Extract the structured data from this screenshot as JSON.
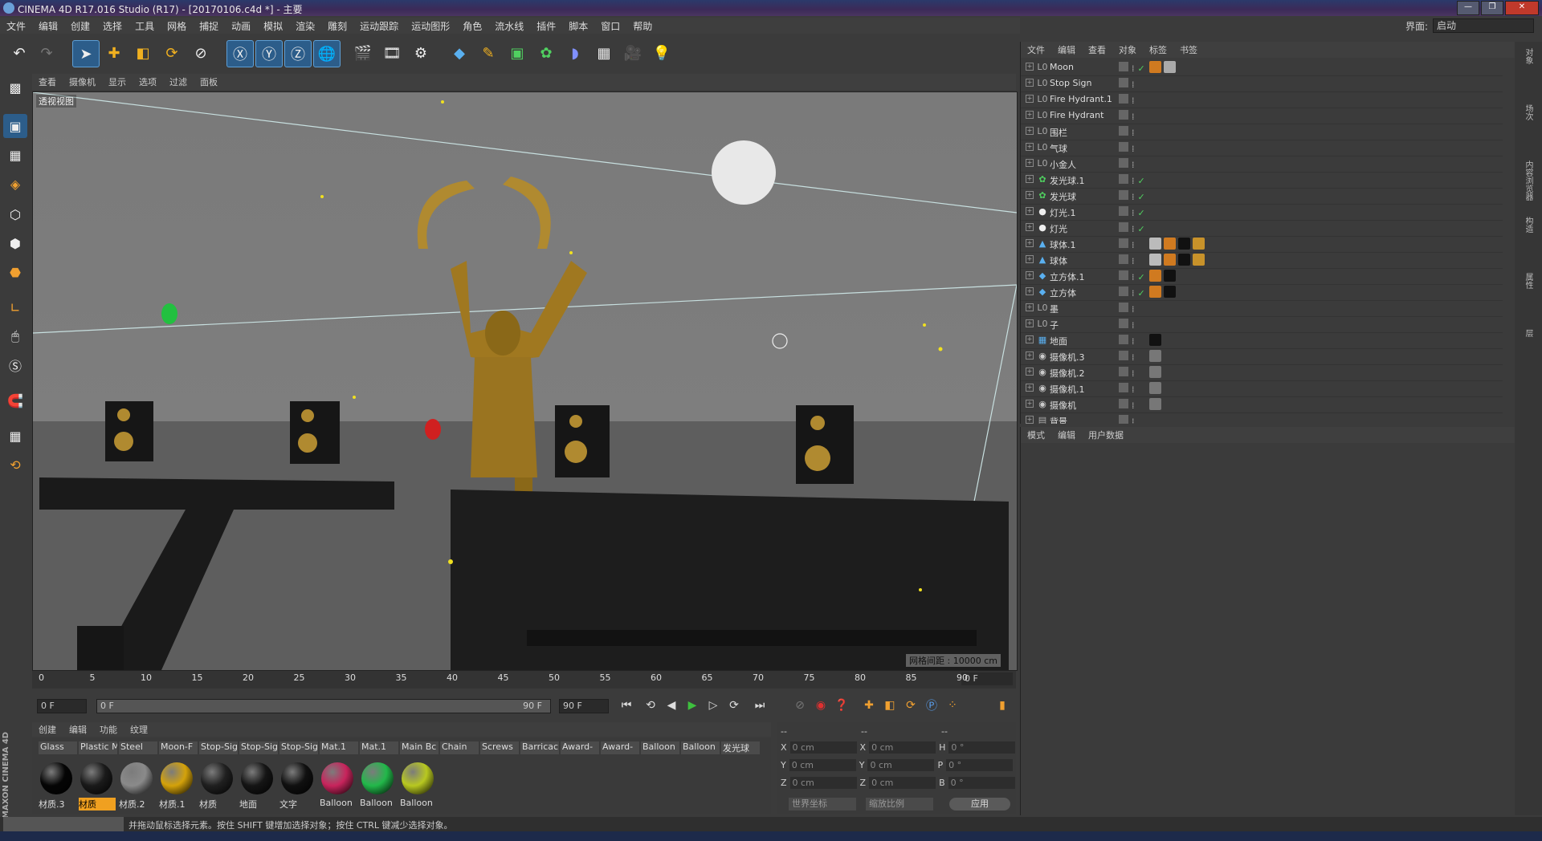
{
  "window": {
    "title": "CINEMA 4D R17.016 Studio (R17) - [20170106.c4d *] - 主要"
  },
  "menu": [
    "文件",
    "编辑",
    "创建",
    "选择",
    "工具",
    "网格",
    "捕捉",
    "动画",
    "模拟",
    "渲染",
    "雕刻",
    "运动跟踪",
    "运动图形",
    "角色",
    "流水线",
    "插件",
    "脚本",
    "窗口",
    "帮助"
  ],
  "layout": {
    "label": "界面:",
    "value": "启动"
  },
  "viewport": {
    "menu": [
      "查看",
      "摄像机",
      "显示",
      "选项",
      "过滤",
      "面板"
    ],
    "label": "透视视图",
    "grid_spacing": "网格间距 : 10000 cm"
  },
  "timeline": {
    "ticks": [
      "0",
      "5",
      "10",
      "15",
      "20",
      "25",
      "30",
      "35",
      "40",
      "45",
      "50",
      "55",
      "60",
      "65",
      "70",
      "75",
      "80",
      "85",
      "90"
    ],
    "current_frame": "0 F"
  },
  "playback": {
    "start": "0 F",
    "range_start": "0 F",
    "range_end": "90 F",
    "end": "90 F"
  },
  "materials": {
    "menu": [
      "创建",
      "编辑",
      "功能",
      "纹理"
    ],
    "tabs": [
      "Glass",
      "Plastic M",
      "Steel",
      "Moon-F",
      "Stop-Sig",
      "Stop-Sig",
      "Stop-Sig",
      "Mat.1",
      "Mat.1",
      "Main Bc",
      "Chain",
      "Screws",
      "Barricac",
      "Award-",
      "Award-",
      "Balloon",
      "Balloon",
      "发光球"
    ],
    "items": [
      {
        "name": "材质.3",
        "color": "#050505"
      },
      {
        "name": "材质",
        "color": "#1a1a1a"
      },
      {
        "name": "材质.2",
        "color": "#8a8a8a"
      },
      {
        "name": "材质.1",
        "color": "#d4a20a"
      },
      {
        "name": "材质",
        "color": "#202020"
      },
      {
        "name": "地面",
        "color": "#151515"
      },
      {
        "name": "文字",
        "color": "#101010"
      },
      {
        "name": "Balloon",
        "color": "#c8245c"
      },
      {
        "name": "Balloon",
        "color": "#22b84a"
      },
      {
        "name": "Balloon",
        "color": "#b8c820"
      }
    ]
  },
  "coords": {
    "headers": [
      "--",
      "--",
      "--"
    ],
    "rows": [
      {
        "a": "X",
        "av": "0 cm",
        "b": "X",
        "bv": "0 cm",
        "c": "H",
        "cv": "0 °"
      },
      {
        "a": "Y",
        "av": "0 cm",
        "b": "Y",
        "bv": "0 cm",
        "c": "P",
        "cv": "0 °"
      },
      {
        "a": "Z",
        "av": "0 cm",
        "b": "Z",
        "bv": "0 cm",
        "c": "B",
        "cv": "0 °"
      }
    ],
    "world": "世界坐标",
    "scale": "缩放比例",
    "apply": "应用"
  },
  "objects": {
    "menu": [
      "文件",
      "编辑",
      "查看",
      "对象",
      "标签",
      "书签"
    ],
    "rows": [
      {
        "name": "Moon",
        "icon": "null",
        "check": true,
        "tags": [
          "#d07a20",
          "#aaaaaa"
        ]
      },
      {
        "name": "Stop Sign",
        "icon": "null",
        "check": false,
        "tags": []
      },
      {
        "name": "Fire Hydrant.1",
        "icon": "null",
        "check": false,
        "tags": []
      },
      {
        "name": "Fire Hydrant",
        "icon": "null",
        "check": false,
        "tags": []
      },
      {
        "name": "围栏",
        "icon": "null",
        "check": false,
        "tags": []
      },
      {
        "name": "气球",
        "icon": "null",
        "check": false,
        "tags": []
      },
      {
        "name": "小金人",
        "icon": "null",
        "check": false,
        "tags": []
      },
      {
        "name": "发光球.1",
        "icon": "clone",
        "check": true,
        "tags": []
      },
      {
        "name": "发光球",
        "icon": "clone",
        "check": true,
        "tags": []
      },
      {
        "name": "灯光.1",
        "icon": "light",
        "check": true,
        "tags": []
      },
      {
        "name": "灯光",
        "icon": "light",
        "check": true,
        "tags": []
      },
      {
        "name": "球体.1",
        "icon": "sphere",
        "check": false,
        "tags": [
          "#bbbbbb",
          "#d07a20",
          "#111111",
          "#c8922a"
        ]
      },
      {
        "name": "球体",
        "icon": "sphere",
        "check": false,
        "tags": [
          "#bbbbbb",
          "#d07a20",
          "#111111",
          "#c8922a"
        ]
      },
      {
        "name": "立方体.1",
        "icon": "cube",
        "check": true,
        "tags": [
          "#d07a20",
          "#111111"
        ]
      },
      {
        "name": "立方体",
        "icon": "cube",
        "check": true,
        "tags": [
          "#d07a20",
          "#111111"
        ]
      },
      {
        "name": "墨",
        "icon": "null",
        "check": false,
        "tags": []
      },
      {
        "name": "子",
        "icon": "null",
        "check": false,
        "tags": []
      },
      {
        "name": "地面",
        "icon": "floor",
        "check": false,
        "tags": [
          "#111111"
        ]
      },
      {
        "name": "摄像机.3",
        "icon": "camera",
        "check": false,
        "tags": [
          "#777777"
        ]
      },
      {
        "name": "摄像机.2",
        "icon": "camera",
        "check": false,
        "tags": [
          "#777777"
        ]
      },
      {
        "name": "摄像机.1",
        "icon": "camera",
        "check": false,
        "tags": [
          "#777777"
        ]
      },
      {
        "name": "摄像机",
        "icon": "camera",
        "check": false,
        "tags": [
          "#777777"
        ]
      },
      {
        "name": "背景",
        "icon": "bg",
        "check": false,
        "tags": []
      }
    ]
  },
  "attributes": {
    "menu": [
      "模式",
      "编辑",
      "用户数据"
    ]
  },
  "status": "并拖动鼠标选择元素。按住 SHIFT 键增加选择对象；按住 CTRL 键减少选择对象。",
  "brand": "MAXON CINEMA 4D",
  "right_tabs": [
    "对象",
    "场次",
    "内容浏览器",
    "构造",
    "属性",
    "层"
  ]
}
